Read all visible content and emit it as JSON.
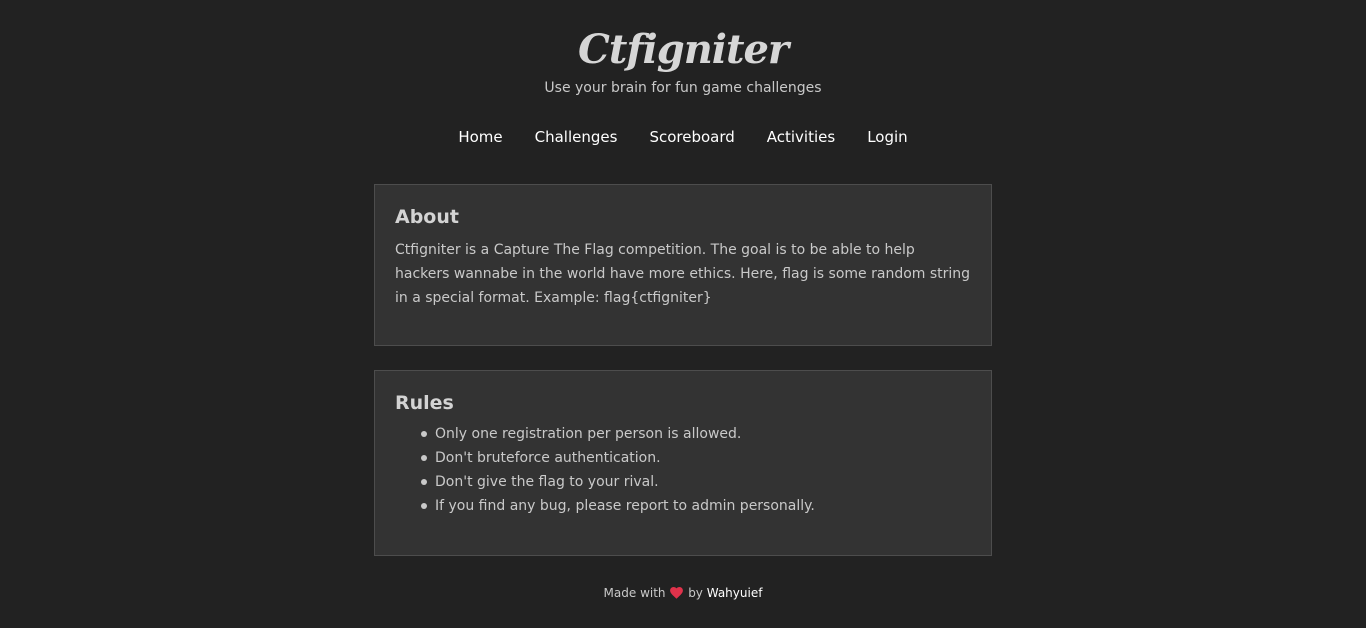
{
  "header": {
    "title": "Ctfigniter",
    "tagline": "Use your brain for fun game challenges"
  },
  "nav": {
    "items": [
      {
        "label": "Home"
      },
      {
        "label": "Challenges"
      },
      {
        "label": "Scoreboard"
      },
      {
        "label": "Activities"
      },
      {
        "label": "Login"
      }
    ]
  },
  "about": {
    "title": "About",
    "text": "Ctfigniter is a Capture The Flag competition. The goal is to be able to help hackers wannabe in the world have more ethics. Here, flag is some random string in a special format. Example: flag{ctfigniter}"
  },
  "rules": {
    "title": "Rules",
    "items": [
      "Only one registration per person is allowed.",
      "Don't bruteforce authentication.",
      "Don't give the flag to your rival.",
      "If you find any bug, please report to admin personally."
    ]
  },
  "footer": {
    "made_with": "Made with",
    "by": "by",
    "author": "Wahyuief",
    "heart_icon": "heart-icon",
    "heart_color": "#e0324b"
  },
  "colors": {
    "background": "#222222",
    "card_background": "#333333",
    "card_border": "#4d4d4d",
    "text": "#c9c9c9",
    "link": "#ffffff"
  }
}
